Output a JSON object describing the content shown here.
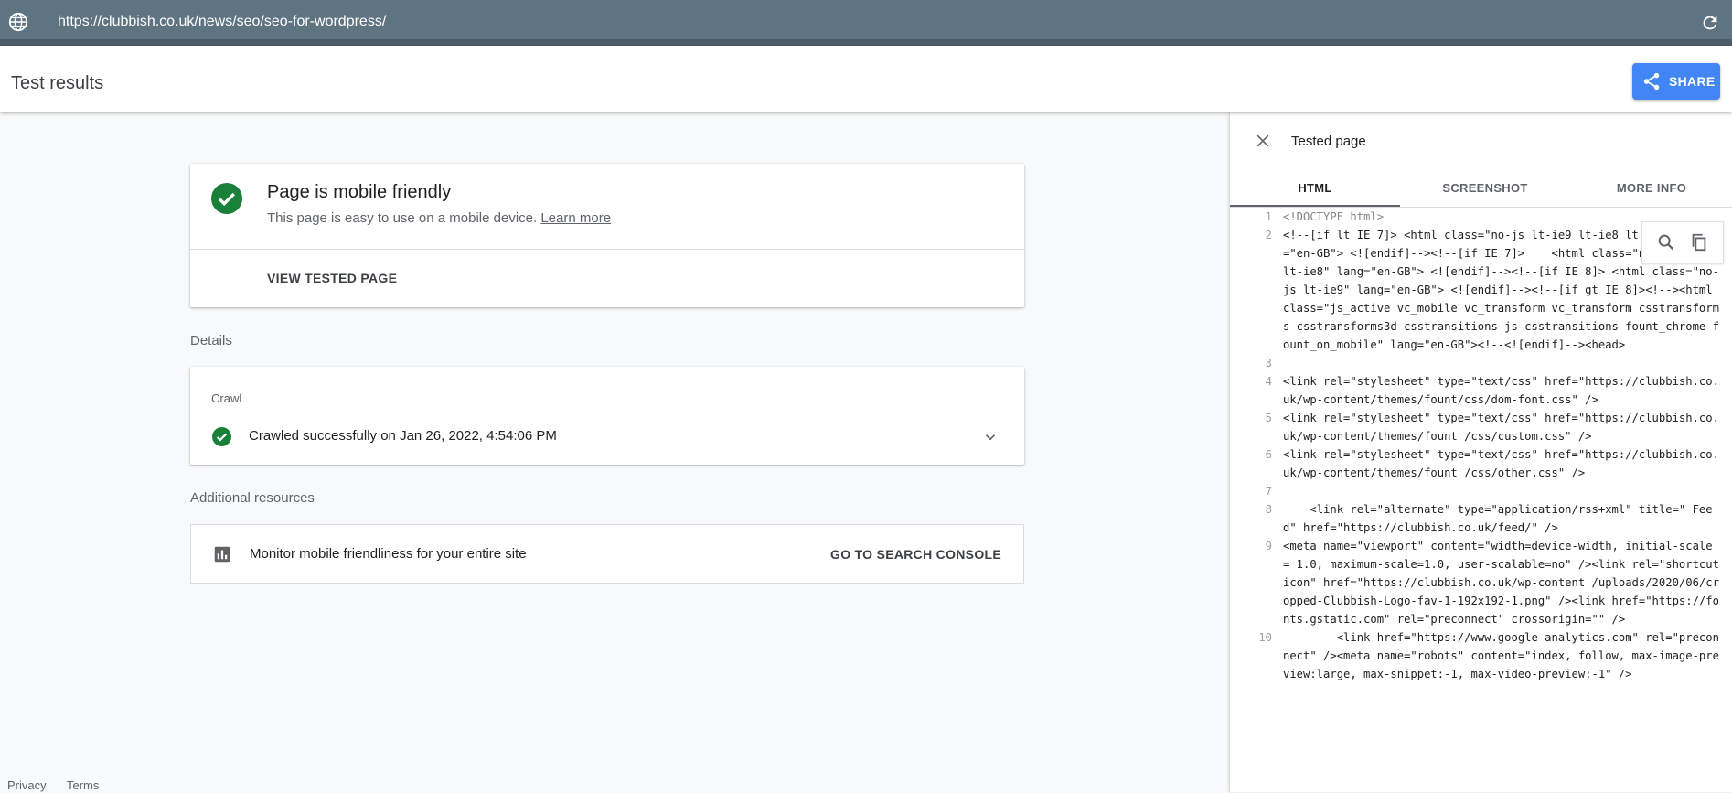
{
  "urlbar": {
    "url": "https://clubbish.co.uk/news/seo/seo-for-wordpress/",
    "globe_icon": "globe-icon",
    "reload_icon": "reload-icon"
  },
  "header": {
    "title": "Test results",
    "share_label": "SHARE",
    "share_color": "#4285f4"
  },
  "status_card": {
    "title": "Page is mobile friendly",
    "subtitle": "This page is easy to use on a mobile device.",
    "learn_more": "Learn more",
    "view_tested": "VIEW TESTED PAGE",
    "status_color": "#188038"
  },
  "details": {
    "label": "Details",
    "crawl_label": "Crawl",
    "crawl_text": "Crawled successfully on Jan 26, 2022, 4:54:06 PM"
  },
  "resources": {
    "label": "Additional resources",
    "monitor_text": "Monitor mobile friendliness for your entire site",
    "console_link": "GO TO SEARCH CONSOLE"
  },
  "footer": {
    "privacy": "Privacy",
    "terms": "Terms"
  },
  "panel": {
    "title": "Tested page",
    "tabs": [
      {
        "label": "HTML",
        "active": true
      },
      {
        "label": "SCREENSHOT",
        "active": false
      },
      {
        "label": "MORE INFO",
        "active": false
      }
    ],
    "code_lines": [
      {
        "n": "1",
        "text": "<!DOCTYPE html>"
      },
      {
        "n": "2",
        "text": "<!--[if lt IE 7]> <html class=\"no-js lt-ie9 lt-ie8 lt-ie7\" lang=\"en-GB\"> <![endif]--><!--[if IE 7]>    <html class=\"no-js lt-ie9 lt-ie8\" lang=\"en-GB\"> <![endif]--><!--[if IE 8]> <html class=\"no-js lt-ie9\" lang=\"en-GB\"> <![endif]--><!--[if gt IE 8]><!--><html class=\"js_active vc_mobile vc_transform vc_transform csstransforms csstransforms3d csstransitions js csstransitions fount_chrome fount_on_mobile\" lang=\"en-GB\"><!--<![endif]--><head>"
      },
      {
        "n": "3",
        "text": ""
      },
      {
        "n": "4",
        "text": "<link rel=\"stylesheet\" type=\"text/css\" href=\"https://clubbish.co.uk/wp-content/themes/fount/css/dom-font.css\" />"
      },
      {
        "n": "5",
        "text": "<link rel=\"stylesheet\" type=\"text/css\" href=\"https://clubbish.co.uk/wp-content/themes/fount /css/custom.css\" />"
      },
      {
        "n": "6",
        "text": "<link rel=\"stylesheet\" type=\"text/css\" href=\"https://clubbish.co.uk/wp-content/themes/fount /css/other.css\" />"
      },
      {
        "n": "7",
        "text": ""
      },
      {
        "n": "8",
        "text": "    <link rel=\"alternate\" type=\"application/rss+xml\" title=\" Feed\" href=\"https://clubbish.co.uk/feed/\" />"
      },
      {
        "n": "9",
        "text": "<meta name=\"viewport\" content=\"width=device-width, initial-scale = 1.0, maximum-scale=1.0, user-scalable=no\" /><link rel=\"shortcut icon\" href=\"https://clubbish.co.uk/wp-content /uploads/2020/06/cropped-Clubbish-Logo-fav-1-192x192-1.png\" /><link href=\"https://fonts.gstatic.com\" rel=\"preconnect\" crossorigin=\"\" />"
      },
      {
        "n": "10",
        "text": "        <link href=\"https://www.google-analytics.com\" rel=\"preconnect\" /><meta name=\"robots\" content=\"index, follow, max-image-preview:large, max-snippet:-1, max-video-preview:-1\" />"
      }
    ]
  }
}
